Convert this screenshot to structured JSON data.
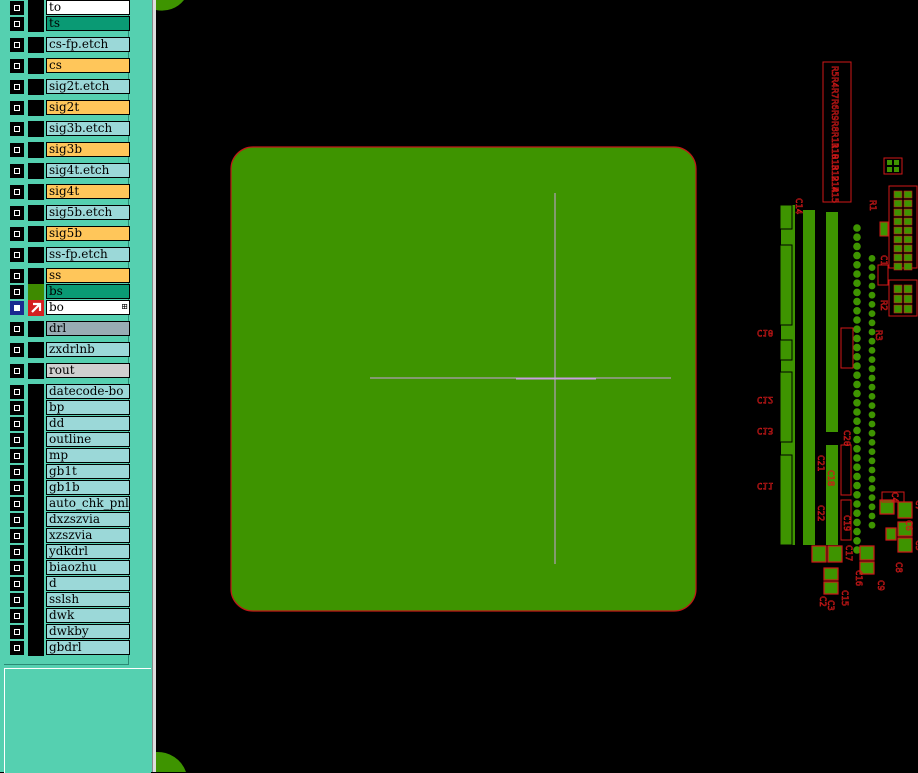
{
  "layers": [
    {
      "name": "to",
      "color": "#ffffff",
      "checked": false,
      "swatch": "#000000"
    },
    {
      "name": "ts",
      "color": "#0a9a74",
      "checked": false,
      "swatch": "#000000"
    },
    {
      "name": "cs-fp.etch",
      "color": "#9bd8d8",
      "checked": false,
      "swatch": "#000000"
    },
    {
      "name": "cs",
      "color": "#ffc65a",
      "checked": false,
      "swatch": "#000000"
    },
    {
      "name": "sig2t.etch",
      "color": "#9bd8d8",
      "checked": false,
      "swatch": "#000000"
    },
    {
      "name": "sig2t",
      "color": "#ffc65a",
      "checked": false,
      "swatch": "#000000"
    },
    {
      "name": "sig3b.etch",
      "color": "#9bd8d8",
      "checked": false,
      "swatch": "#000000"
    },
    {
      "name": "sig3b",
      "color": "#ffc65a",
      "checked": false,
      "swatch": "#000000"
    },
    {
      "name": "sig4t.etch",
      "color": "#9bd8d8",
      "checked": false,
      "swatch": "#000000"
    },
    {
      "name": "sig4t",
      "color": "#ffc65a",
      "checked": false,
      "swatch": "#000000"
    },
    {
      "name": "sig5b.etch",
      "color": "#9bd8d8",
      "checked": false,
      "swatch": "#000000"
    },
    {
      "name": "sig5b",
      "color": "#ffc65a",
      "checked": false,
      "swatch": "#000000"
    },
    {
      "name": "ss-fp.etch",
      "color": "#9bd8d8",
      "checked": false,
      "swatch": "#000000"
    },
    {
      "name": "ss",
      "color": "#ffc65a",
      "checked": false,
      "swatch": "#000000"
    },
    {
      "name": "bs",
      "color": "#0a9a74",
      "checked": false,
      "swatch": "#3e8a00"
    },
    {
      "name": "bo",
      "color": "#ffffff",
      "checked": true,
      "swatch": "#d42020",
      "active": true,
      "marker": "⊞"
    },
    {
      "name": "drl",
      "color": "#98acb4",
      "checked": false,
      "swatch": "#000000"
    },
    {
      "name": "zxdrlnb",
      "color": "#9bd8d8",
      "checked": false,
      "swatch": "#000000"
    },
    {
      "name": "rout",
      "color": "#d0d0d0",
      "checked": false,
      "swatch": "#000000"
    },
    {
      "name": "datecode-bo",
      "color": "#9bd8d8",
      "checked": false,
      "swatch": "#000000"
    },
    {
      "name": "bp",
      "color": "#9bd8d8",
      "checked": false,
      "swatch": "#000000"
    },
    {
      "name": "dd",
      "color": "#9bd8d8",
      "checked": false,
      "swatch": "#000000"
    },
    {
      "name": "outline",
      "color": "#9bd8d8",
      "checked": false,
      "swatch": "#000000"
    },
    {
      "name": "mp",
      "color": "#9bd8d8",
      "checked": false,
      "swatch": "#000000"
    },
    {
      "name": "gb1t",
      "color": "#9bd8d8",
      "checked": false,
      "swatch": "#000000"
    },
    {
      "name": "gb1b",
      "color": "#9bd8d8",
      "checked": false,
      "swatch": "#000000"
    },
    {
      "name": "auto_chk_pnl",
      "color": "#9bd8d8",
      "checked": false,
      "swatch": "#000000"
    },
    {
      "name": "dxzszvia",
      "color": "#9bd8d8",
      "checked": false,
      "swatch": "#000000"
    },
    {
      "name": "xzszvia",
      "color": "#9bd8d8",
      "checked": false,
      "swatch": "#000000"
    },
    {
      "name": "ydkdrl",
      "color": "#9bd8d8",
      "checked": false,
      "swatch": "#000000"
    },
    {
      "name": "biaozhu",
      "color": "#9bd8d8",
      "checked": false,
      "swatch": "#000000"
    },
    {
      "name": "d",
      "color": "#9bd8d8",
      "checked": false,
      "swatch": "#000000"
    },
    {
      "name": "sslsh",
      "color": "#9bd8d8",
      "checked": false,
      "swatch": "#000000"
    },
    {
      "name": "dwk",
      "color": "#9bd8d8",
      "checked": false,
      "swatch": "#000000"
    },
    {
      "name": "dwkby",
      "color": "#9bd8d8",
      "checked": false,
      "swatch": "#000000"
    },
    {
      "name": "gbdrl",
      "color": "#9bd8d8",
      "checked": false,
      "swatch": "#000000"
    }
  ],
  "board": {
    "fill": "#3e9400",
    "outline": "#c01818",
    "cursor_color": "#c8a0e0"
  },
  "refdes": {
    "resistor_column": [
      "R5",
      "R4",
      "R7",
      "R6",
      "R9",
      "R8",
      "R11",
      "R10",
      "R13",
      "R12",
      "R14",
      "R15"
    ],
    "caps_left": [
      "C10",
      "C12",
      "C13",
      "C11"
    ],
    "misc": [
      "C14",
      "C21",
      "C20",
      "C18",
      "C22",
      "C19",
      "C17",
      "C16",
      "C15",
      "C9",
      "C8",
      "C7",
      "C6",
      "C5",
      "C4",
      "C3",
      "C2",
      "C1",
      "R2",
      "R3",
      "R1"
    ]
  },
  "colors": {
    "panel": "#55d0b0",
    "silk_red": "#d01818",
    "pad_green": "#3e9400"
  }
}
